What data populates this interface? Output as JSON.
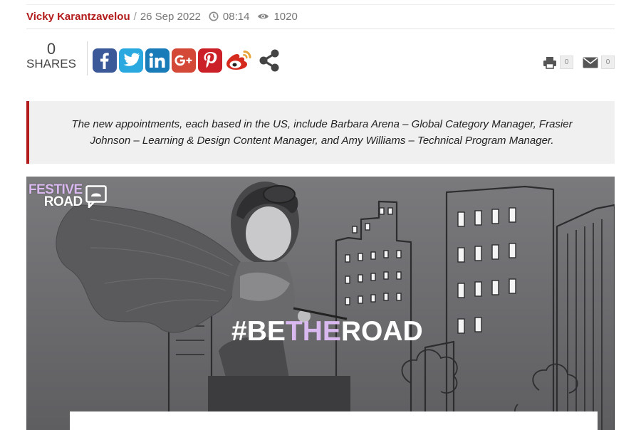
{
  "meta": {
    "author": "Vicky Karantzavelou",
    "separator": "/",
    "date": "26 Sep 2022",
    "time": "08:14",
    "views": "1020"
  },
  "shares": {
    "count": "0",
    "label": "SHARES"
  },
  "social": [
    {
      "name": "facebook",
      "icon": "facebook-icon",
      "color": "#3b5998"
    },
    {
      "name": "twitter",
      "icon": "twitter-icon",
      "color": "#2aa9e0"
    },
    {
      "name": "linkedin",
      "icon": "linkedin-icon",
      "color": "#1a7bb9"
    },
    {
      "name": "google-plus",
      "icon": "google-plus-icon",
      "color": "#d34836"
    },
    {
      "name": "pinterest",
      "icon": "pinterest-icon",
      "color": "#cb2027"
    },
    {
      "name": "weibo",
      "icon": "weibo-icon",
      "color": "#d52b1e"
    },
    {
      "name": "share",
      "icon": "share-icon",
      "color": "#444444"
    }
  ],
  "utility": {
    "print_count": "0",
    "email_count": "0"
  },
  "summary": "The new appointments, each based in the US, include Barbara Arena – Global Category Manager, Frasier Johnson – Learning & Design Content Manager, and Amy Williams – Technical Program Manager.",
  "hero": {
    "logo_line1": "FESTIVE",
    "logo_line2": "ROAD",
    "tagline_part1": "#BE",
    "tagline_part2": "THE",
    "tagline_part3": "ROAD"
  },
  "colors": {
    "accent": "#b31b1b",
    "lavender": "#d8b8ee"
  }
}
